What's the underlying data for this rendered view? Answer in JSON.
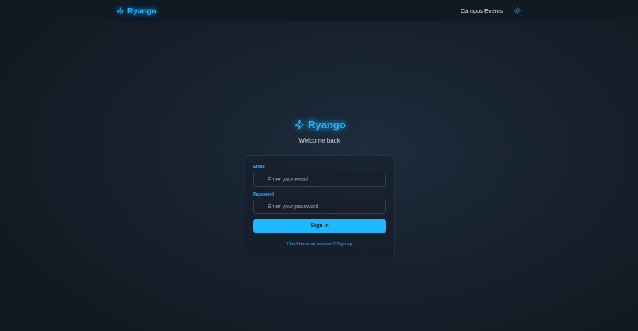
{
  "header": {
    "brand": "Ryango",
    "nav_link": "Campus Events",
    "theme_icon": "sun-icon"
  },
  "hero": {
    "brand": "Ryango",
    "subtitle": "Welcome back"
  },
  "form": {
    "email": {
      "label": "Email",
      "placeholder": "Enter your email",
      "value": "",
      "icon": "mail-icon"
    },
    "password": {
      "label": "Password",
      "placeholder": "Enter your password",
      "value": "",
      "icon": "lock-icon"
    },
    "submit_label": "Sign In",
    "signup_text": "Don't have an account? Sign up"
  },
  "colors": {
    "accent": "#1fb7ff",
    "background": "#18222f",
    "header_background": "#111923"
  }
}
